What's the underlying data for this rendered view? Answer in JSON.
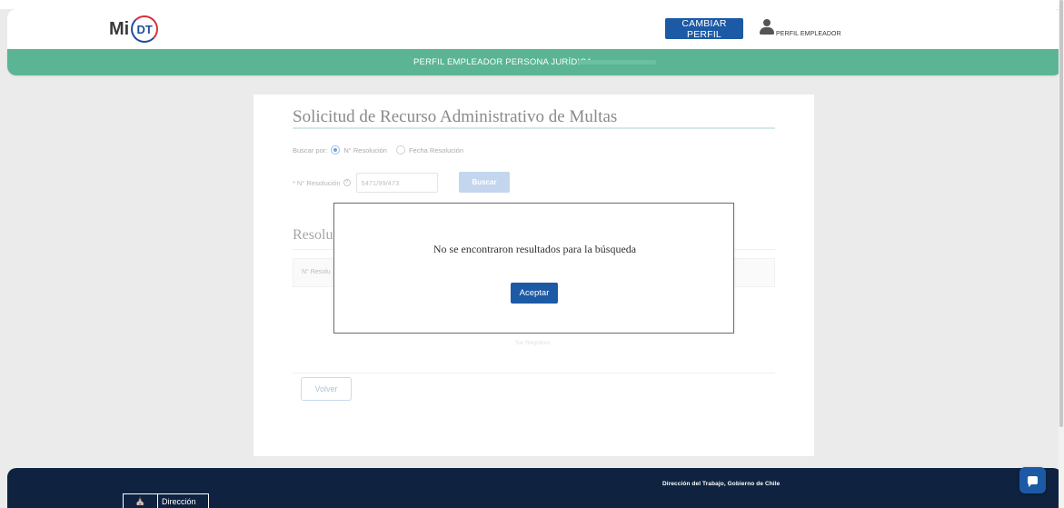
{
  "header": {
    "logo_text": "Mi",
    "logo_badge": "DT",
    "change_profile_label": "CAMBIAR PERFIL",
    "user_label": "PERFIL EMPLEADOR"
  },
  "profile_bar": {
    "text": "PERFIL EMPLEADOR PERSONA JURÍDICA:"
  },
  "form": {
    "title": "Solicitud de Recurso Administrativo de Multas",
    "search_by_label": "Buscar por:",
    "options": [
      {
        "label": "N° Resolución",
        "selected": true
      },
      {
        "label": "Fecha Resolución",
        "selected": false
      }
    ],
    "resolution_label": "N° Resolución",
    "resolution_required": "*",
    "help_glyph": "?",
    "resolution_value": "5471/99/473",
    "search_button": "Buscar",
    "results_title": "Resolu",
    "table_header_col": "N° Resolu",
    "no_data_text": "Sin Registros",
    "back_button": "Volver"
  },
  "modal": {
    "message": "No se encontraron resultados para la búsqueda",
    "accept_button": "Aceptar"
  },
  "footer": {
    "logo_text": "Dirección",
    "credit": "Dirección del Trabajo, Gobierno de Chile"
  },
  "colors": {
    "primary": "#1c5aa6",
    "profile_bar": "#5bb594",
    "footer": "#0f2340",
    "logo_red": "#d6323c"
  }
}
